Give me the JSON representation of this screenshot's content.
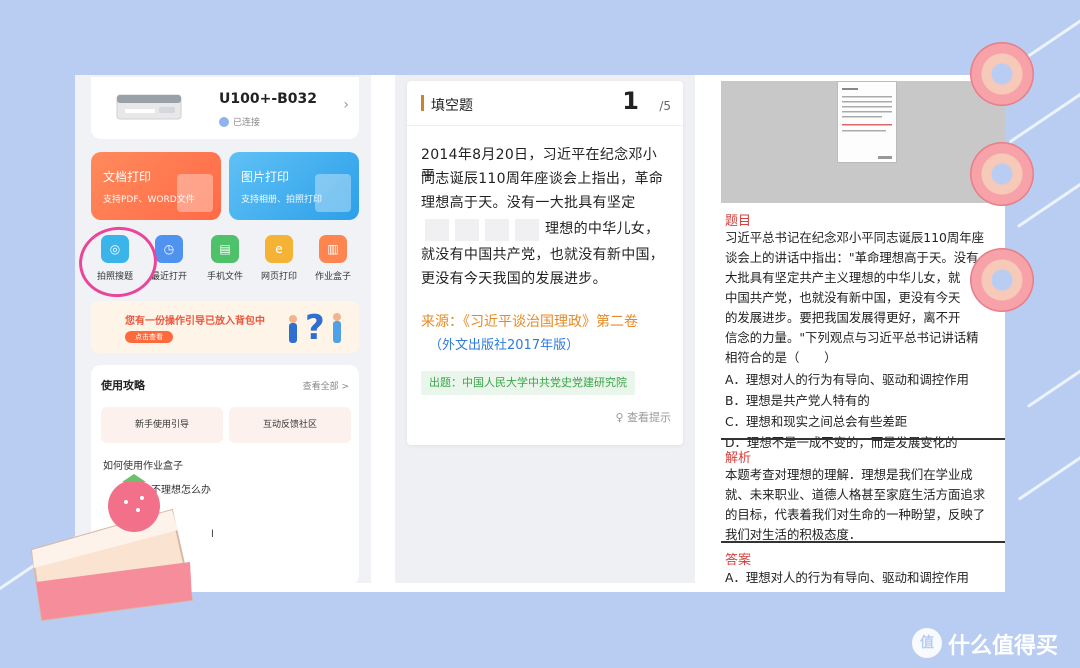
{
  "left_panel": {
    "device": {
      "name": "U100+-B032",
      "status": "已连接"
    },
    "print_buttons": [
      {
        "title": "文档打印",
        "subtitle": "支持PDF、WORD文件"
      },
      {
        "title": "图片打印",
        "subtitle": "支持相册、拍照打印"
      }
    ],
    "tools": [
      {
        "label": "拍照搜题",
        "icon": "camera-search-icon",
        "color": "#3bb4ea"
      },
      {
        "label": "最近打开",
        "icon": "clock-icon",
        "color": "#4f92ef"
      },
      {
        "label": "手机文件",
        "icon": "folder-icon",
        "color": "#4fc16a"
      },
      {
        "label": "网页打印",
        "icon": "web-icon",
        "color": "#f5b335"
      },
      {
        "label": "作业盒子",
        "icon": "box-icon",
        "color": "#ff8550"
      }
    ],
    "banner": {
      "text": "您有一份操作引导已放入背包中",
      "button": "点击查看"
    },
    "guide": {
      "title": "使用攻略",
      "more": "查看全部 >",
      "buttons": [
        "新手使用引导",
        "互动反馈社区"
      ],
      "items": [
        "如何使用作业盒子",
        "不理想怎么办",
        "l"
      ]
    }
  },
  "question": {
    "type": "填空题",
    "number": "1",
    "total": "/5",
    "text_line1": "2014年8月20日，习近平在纪念邓小平",
    "text_line2": "同志诞辰110周年座谈会上指出，革命",
    "text_line3": "理想高于天。没有一大批具有坚定",
    "text_line4": "理想的中华儿女，",
    "text_line5": "就没有中国共产党，也就没有新中国，",
    "text_line6": "更没有今天我国的发展进步。",
    "source_line1": "来源：《习近平谈治国理政》第二卷",
    "source_line2": "（外文出版社2017年版）",
    "origin": "出题：中国人民大学中共党史党建研究院",
    "hint": "查看提示"
  },
  "answer_panel": {
    "question_title": "题目",
    "question_lines": [
      "习近平总书记在纪念邓小平同志诞辰110周年座",
      "谈会上的讲话中指出：\"革命理想高于天。没有",
      "大批具有坚定共产主义理想的中华儿女，就",
      "中国共产党，也就没有新中国，更没有今天",
      "的发展进步。要把我国发展得更好，离不开",
      "信念的力量。\"下列观点与习近平总书记讲话精",
      "相符合的是（　　）"
    ],
    "options": [
      "A．理想对人的行为有导向、驱动和调控作用",
      "B．理想是共产党人特有的",
      "C．理想和现实之间总会有些差距",
      "D．理想不是一成不变的，而是发展变化的"
    ],
    "analysis_title": "解析",
    "analysis_lines": [
      "本题考查对理想的理解．理想是我们在学业成",
      "就、未来职业、道德人格甚至家庭生活方面追求",
      "的目标，代表着我们对生命的一种盼望，反映了",
      "我们对生活的积极态度．"
    ],
    "answer_title": "答案",
    "answer": "A．理想对人的行为有导向、驱动和调控作用"
  },
  "watermark": {
    "icon": "值",
    "text": "什么值得买"
  }
}
